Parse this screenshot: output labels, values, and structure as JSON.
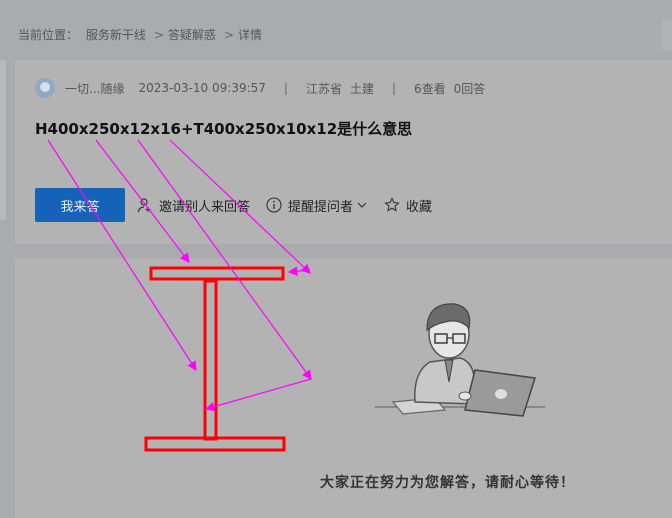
{
  "breadcrumb": {
    "prefix": "当前位置：",
    "items": [
      "服务新干线",
      "答疑解惑",
      "详情"
    ],
    "separator": ">"
  },
  "question": {
    "author": "一切...随缘",
    "datetime": "2023-03-10 09:39:57",
    "province": "江苏省",
    "category": "土建",
    "views": "6查看",
    "answers": "0回答",
    "title": "H400x250x12x16+T400x250x10x12是什么意思"
  },
  "actions": {
    "answer": "我来答",
    "invite": "邀请别人来回答",
    "remind": "提醒提问者",
    "favorite": "收藏"
  },
  "empty_state": {
    "message": "大家正在努力为您解答，请耐心等待！"
  },
  "colors": {
    "accent": "#1463b8",
    "beam": "#ff0000",
    "arrows": "#ff00ff"
  }
}
